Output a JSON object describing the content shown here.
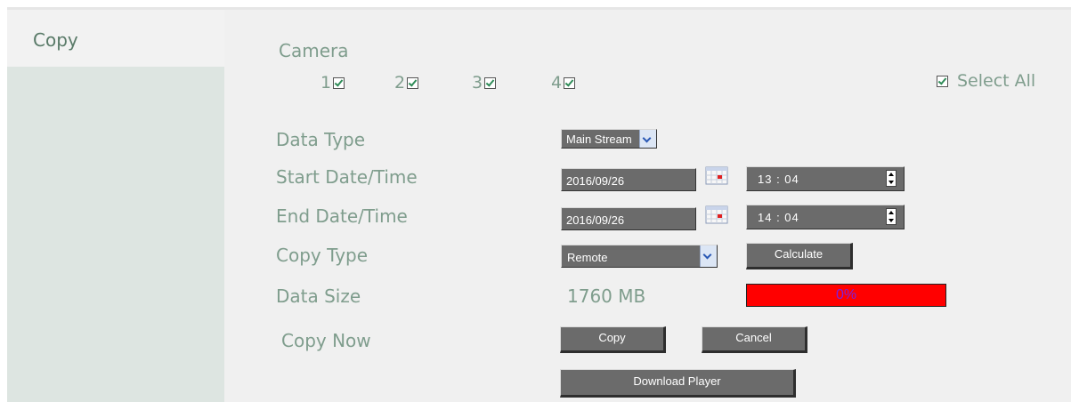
{
  "sidebar": {
    "active_item": "Copy"
  },
  "camera": {
    "label": "Camera",
    "items": [
      {
        "num": "1",
        "checked": true
      },
      {
        "num": "2",
        "checked": true
      },
      {
        "num": "3",
        "checked": true
      },
      {
        "num": "4",
        "checked": true
      }
    ],
    "select_all_label": "Select All",
    "select_all_checked": true
  },
  "data_type": {
    "label": "Data Type",
    "value": "Main Stream"
  },
  "start": {
    "label": "Start Date/Time",
    "date": "2016/09/26",
    "time": "13 : 04"
  },
  "end": {
    "label": "End Date/Time",
    "date": "2016/09/26",
    "time": "14 : 04"
  },
  "copy_type": {
    "label": "Copy Type",
    "value": "Remote",
    "calculate_label": "Calculate"
  },
  "data_size": {
    "label": "Data Size",
    "value": "1760 MB",
    "progress_text": "0%",
    "progress_percent": 0
  },
  "copy_now": {
    "label": "Copy Now",
    "copy_label": "Copy",
    "cancel_label": "Cancel"
  },
  "download_player_label": "Download Player",
  "colors": {
    "label_text": "#7f9d8d",
    "sidebar_bg": "#dde5e1",
    "main_bg": "#f0f0f0",
    "field_bg": "#6b6b6b",
    "progress_fill": "#ff0000",
    "progress_text": "#7b1fe0"
  }
}
